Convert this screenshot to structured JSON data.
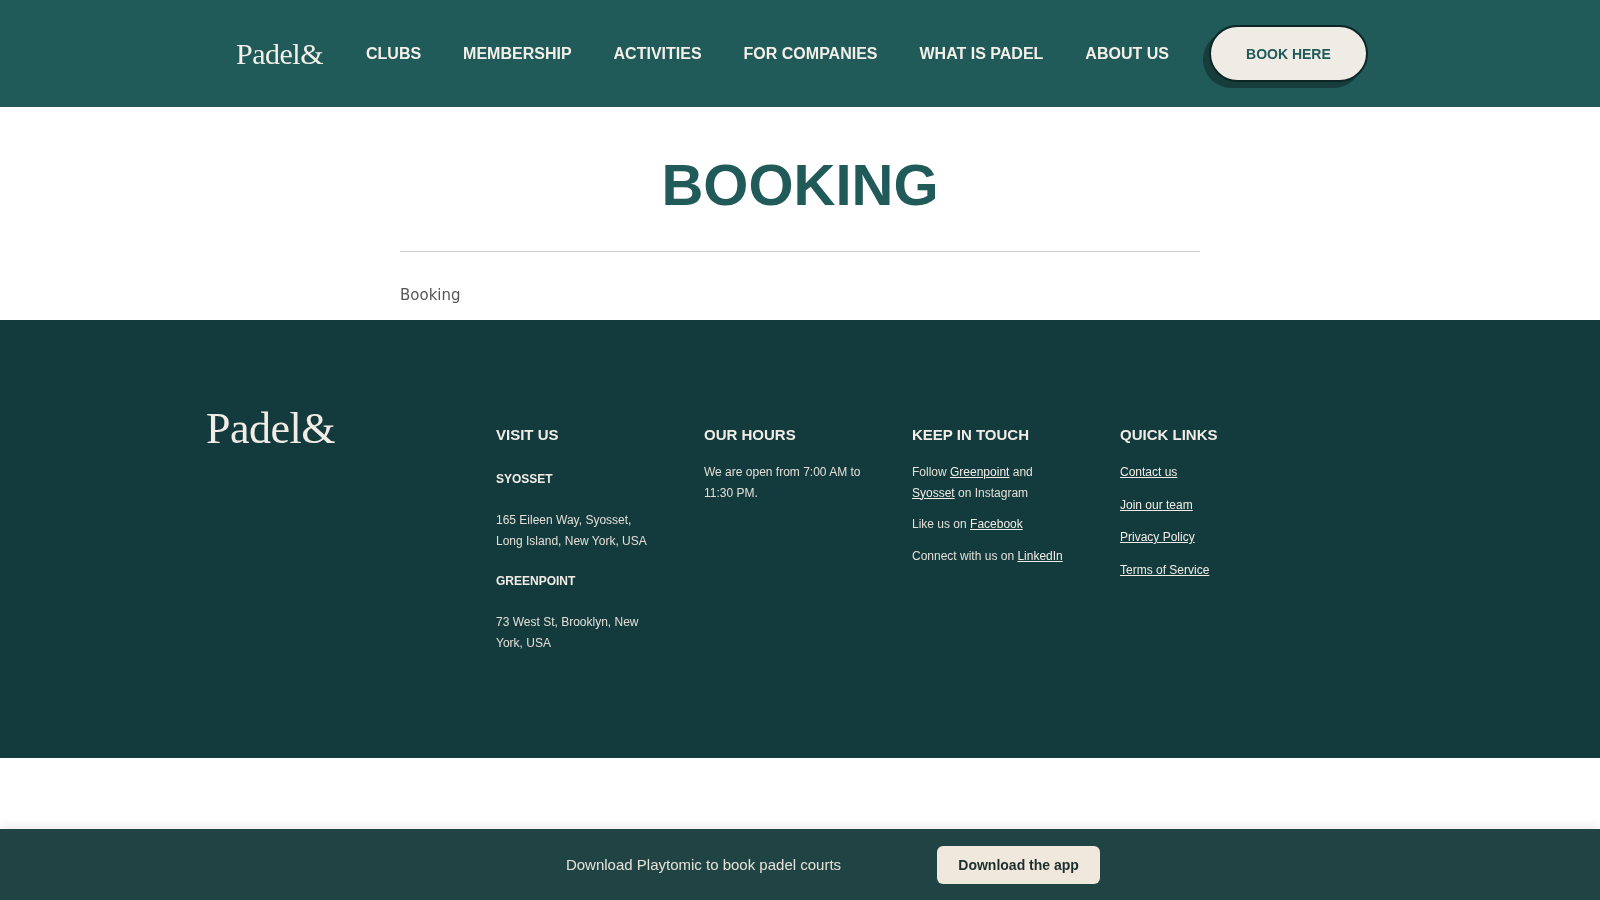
{
  "header": {
    "logo": "Padel&",
    "nav": [
      "CLUBS",
      "MEMBERSHIP",
      "ACTIVITIES",
      "FOR COMPANIES",
      "WHAT IS PADEL",
      "ABOUT US"
    ],
    "cta": "BOOK HERE"
  },
  "page": {
    "title": "BOOKING",
    "body": "Booking"
  },
  "footer": {
    "logo": "Padel&",
    "visit_us": {
      "heading": "VISIT US",
      "locations": [
        {
          "name": "SYOSSET",
          "address": "165 Eileen Way, Syosset, Long Island, New York, USA"
        },
        {
          "name": "GREENPOINT",
          "address": "73 West St, Brooklyn, New York, USA"
        }
      ]
    },
    "our_hours": {
      "heading": "OUR HOURS",
      "text": "We are open from 7:00 AM to 11:30 PM."
    },
    "keep_in_touch": {
      "heading": "KEEP IN TOUCH",
      "paragraphs": [
        {
          "parts": [
            {
              "kind": "text",
              "text": "Follow "
            },
            {
              "kind": "link",
              "text": "Greenpoint"
            },
            {
              "kind": "text",
              "text": " and "
            },
            {
              "kind": "link",
              "text": "Syosset"
            },
            {
              "kind": "text",
              "text": " on Instagram"
            }
          ]
        },
        {
          "parts": [
            {
              "kind": "text",
              "text": "Like us on "
            },
            {
              "kind": "link",
              "text": "Facebook"
            }
          ]
        },
        {
          "parts": [
            {
              "kind": "text",
              "text": "Connect with us on "
            },
            {
              "kind": "link",
              "text": "LinkedIn"
            }
          ]
        }
      ]
    },
    "quick_links": {
      "heading": "QUICK LINKS",
      "links": [
        "Contact us",
        "Join our team",
        "Privacy Policy",
        "Terms of Service"
      ]
    }
  },
  "app_banner": {
    "text": "Download Playtomic to book padel courts",
    "button": "Download the app"
  }
}
